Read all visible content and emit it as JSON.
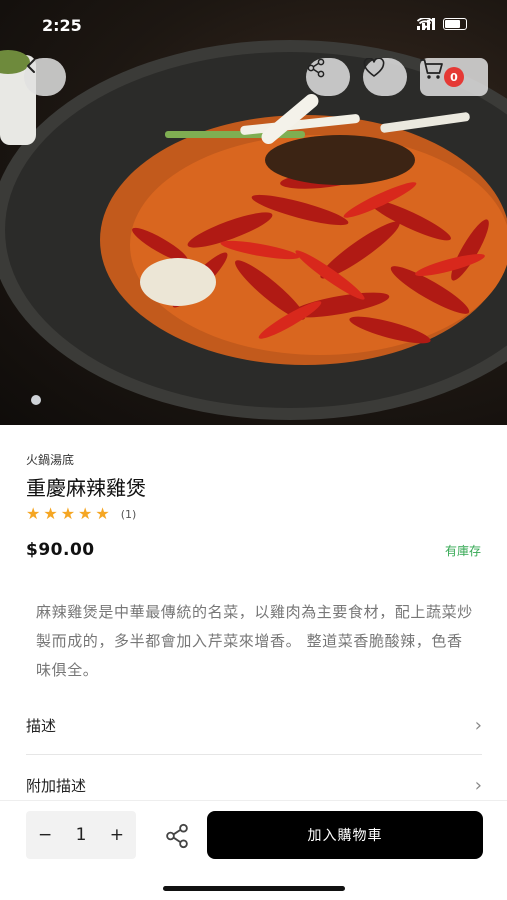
{
  "status": {
    "time": "2:25"
  },
  "hero": {
    "image_alt": "Spicy chicken hot pot with dried chilies",
    "page_dots": 1
  },
  "header": {
    "cart_count": "0"
  },
  "product": {
    "category": "火鍋湯底",
    "title": "重慶麻辣雞煲",
    "rating_stars": 5,
    "rating_count": "(1)",
    "price": "$90.00",
    "stock": "有庫存",
    "description": "麻辣雞煲是中華最傳統的名菜，以雞肉為主要食材，配上蔬菜炒製而成的，多半都會加入芹菜來增香。 整道菜香脆酸辣，色香味俱全。"
  },
  "sections": [
    {
      "label": "描述"
    },
    {
      "label": "附加描述"
    }
  ],
  "bottom": {
    "minus": "−",
    "quantity": "1",
    "plus": "+",
    "add_to_cart": "加入購物車"
  },
  "colors": {
    "accent": "#000000",
    "star": "#f5a623",
    "stock": "#34a853",
    "badge": "#e53935"
  },
  "icons": [
    "back-icon",
    "share-icon",
    "heart-icon",
    "cart-icon",
    "chevron-right-icon",
    "star-icon"
  ]
}
